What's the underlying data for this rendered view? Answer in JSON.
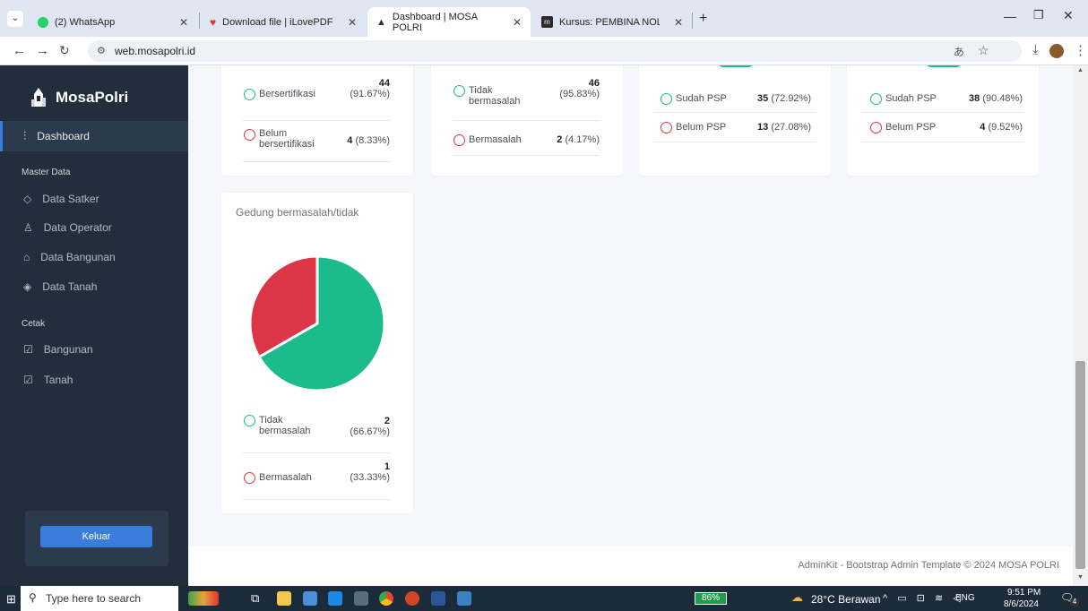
{
  "browser": {
    "tabs": [
      {
        "label": "(2) WhatsApp",
        "icon": "whatsapp-icon",
        "active": false
      },
      {
        "label": "Download file | iLovePDF",
        "icon": "ilovepdf-icon",
        "active": false
      },
      {
        "label": "Dashboard | MOSA POLRI",
        "icon": "mosa-icon",
        "active": true
      },
      {
        "label": "Kursus: PEMBINA NOLIK DWI A",
        "icon": "moodle-icon",
        "active": false
      }
    ],
    "url": "web.mosapolri.id"
  },
  "sidebar": {
    "brand": "MosaPolri",
    "dashboard": "Dashboard",
    "master_header": "Master Data",
    "master_items": [
      "Data Satker",
      "Data Operator",
      "Data Bangunan",
      "Data Tanah"
    ],
    "cetak_header": "Cetak",
    "cetak_items": [
      "Bangunan",
      "Tanah"
    ],
    "logout": "Keluar"
  },
  "cards": {
    "sertifikasi": {
      "rows": [
        {
          "label": "Bersertifikasi",
          "count": "44",
          "pct": "(91.67%)"
        },
        {
          "label": "Belum bersertifikasi",
          "count": "4",
          "pct": "(8.33%)"
        }
      ]
    },
    "masalah": {
      "rows": [
        {
          "label": "Tidak bermasalah",
          "count": "46",
          "pct": "(95.83%)"
        },
        {
          "label": "Bermasalah",
          "count": "2",
          "pct": "(4.17%)"
        }
      ]
    },
    "psp1": {
      "rows": [
        {
          "label": "Sudah PSP",
          "count": "35",
          "pct": "(72.92%)"
        },
        {
          "label": "Belum PSP",
          "count": "13",
          "pct": "(27.08%)"
        }
      ]
    },
    "psp2": {
      "rows": [
        {
          "label": "Sudah PSP",
          "count": "38",
          "pct": "(90.48%)"
        },
        {
          "label": "Belum PSP",
          "count": "4",
          "pct": "(9.52%)"
        }
      ]
    },
    "gedung": {
      "title": "Gedung bermasalah/tidak",
      "rows": [
        {
          "label": "Tidak bermasalah",
          "count": "2",
          "pct": "(66.67%)"
        },
        {
          "label": "Bermasalah",
          "count": "1",
          "pct": "(33.33%)"
        }
      ]
    }
  },
  "chart_data": {
    "type": "pie",
    "categories": [
      "Tidak bermasalah",
      "Bermasalah"
    ],
    "values": [
      2,
      1
    ],
    "colors": [
      "#1cbb8c",
      "#dc3545"
    ]
  },
  "footer": {
    "text": "AdminKit - Bootstrap Admin Template © 2024 MOSA POLRI"
  },
  "taskbar": {
    "search_placeholder": "Type here to search",
    "battery": "86%",
    "weather": "28°C Berawan",
    "lang": "ENG",
    "time": "9:51 PM",
    "date": "8/6/2024",
    "notif_count": "4"
  },
  "colors": {
    "sidebar_bg": "#222e3c",
    "accent": "#3b7ddd",
    "green": "#1cbb8c",
    "red": "#dc3545"
  }
}
